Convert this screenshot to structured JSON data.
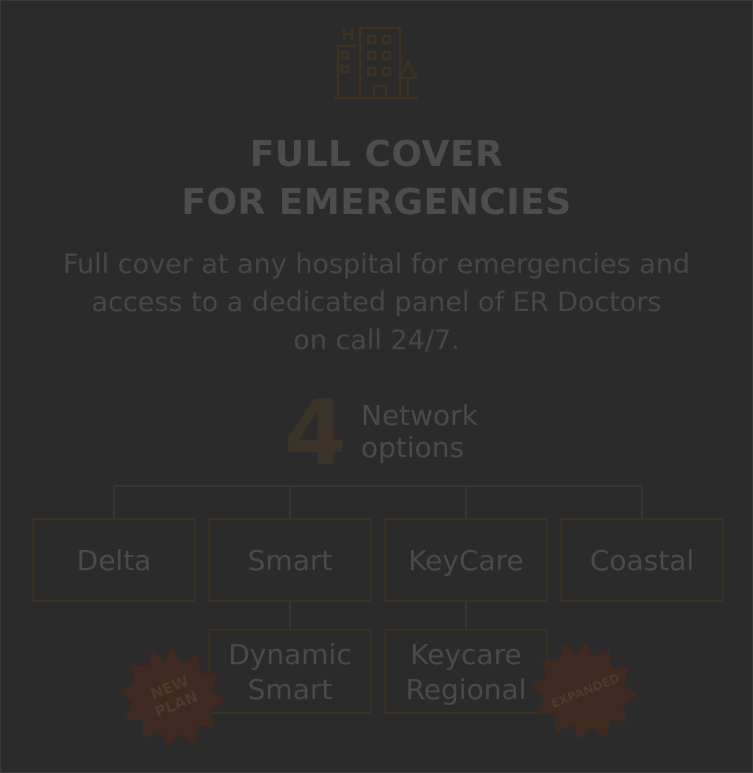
{
  "title_lines": [
    "FULL COVER",
    "FOR EMERGENCIES"
  ],
  "description_lines": [
    "Full cover at any hospital for emergencies and",
    "access to a dedicated panel of ER Doctors",
    "on call 24/7."
  ],
  "network": {
    "count": "4",
    "label_line1": "Network",
    "label_line2": "options"
  },
  "networks": [
    "Delta",
    "Smart",
    "KeyCare",
    "Coastal"
  ],
  "sub_networks": [
    {
      "parent": "Smart",
      "line1": "Dynamic",
      "line2": "Smart"
    },
    {
      "parent": "KeyCare",
      "line1": "Keycare",
      "line2": "Regional"
    }
  ],
  "badges": {
    "new_plan": [
      "NEW",
      "PLAN"
    ],
    "expanded": "EXPANDED"
  },
  "icon": "hospital-building-icon",
  "colors": {
    "background": "#2b2b2b",
    "accent": "#3b3228",
    "badge": "#3e2a20",
    "text": "#4a4a4a"
  }
}
